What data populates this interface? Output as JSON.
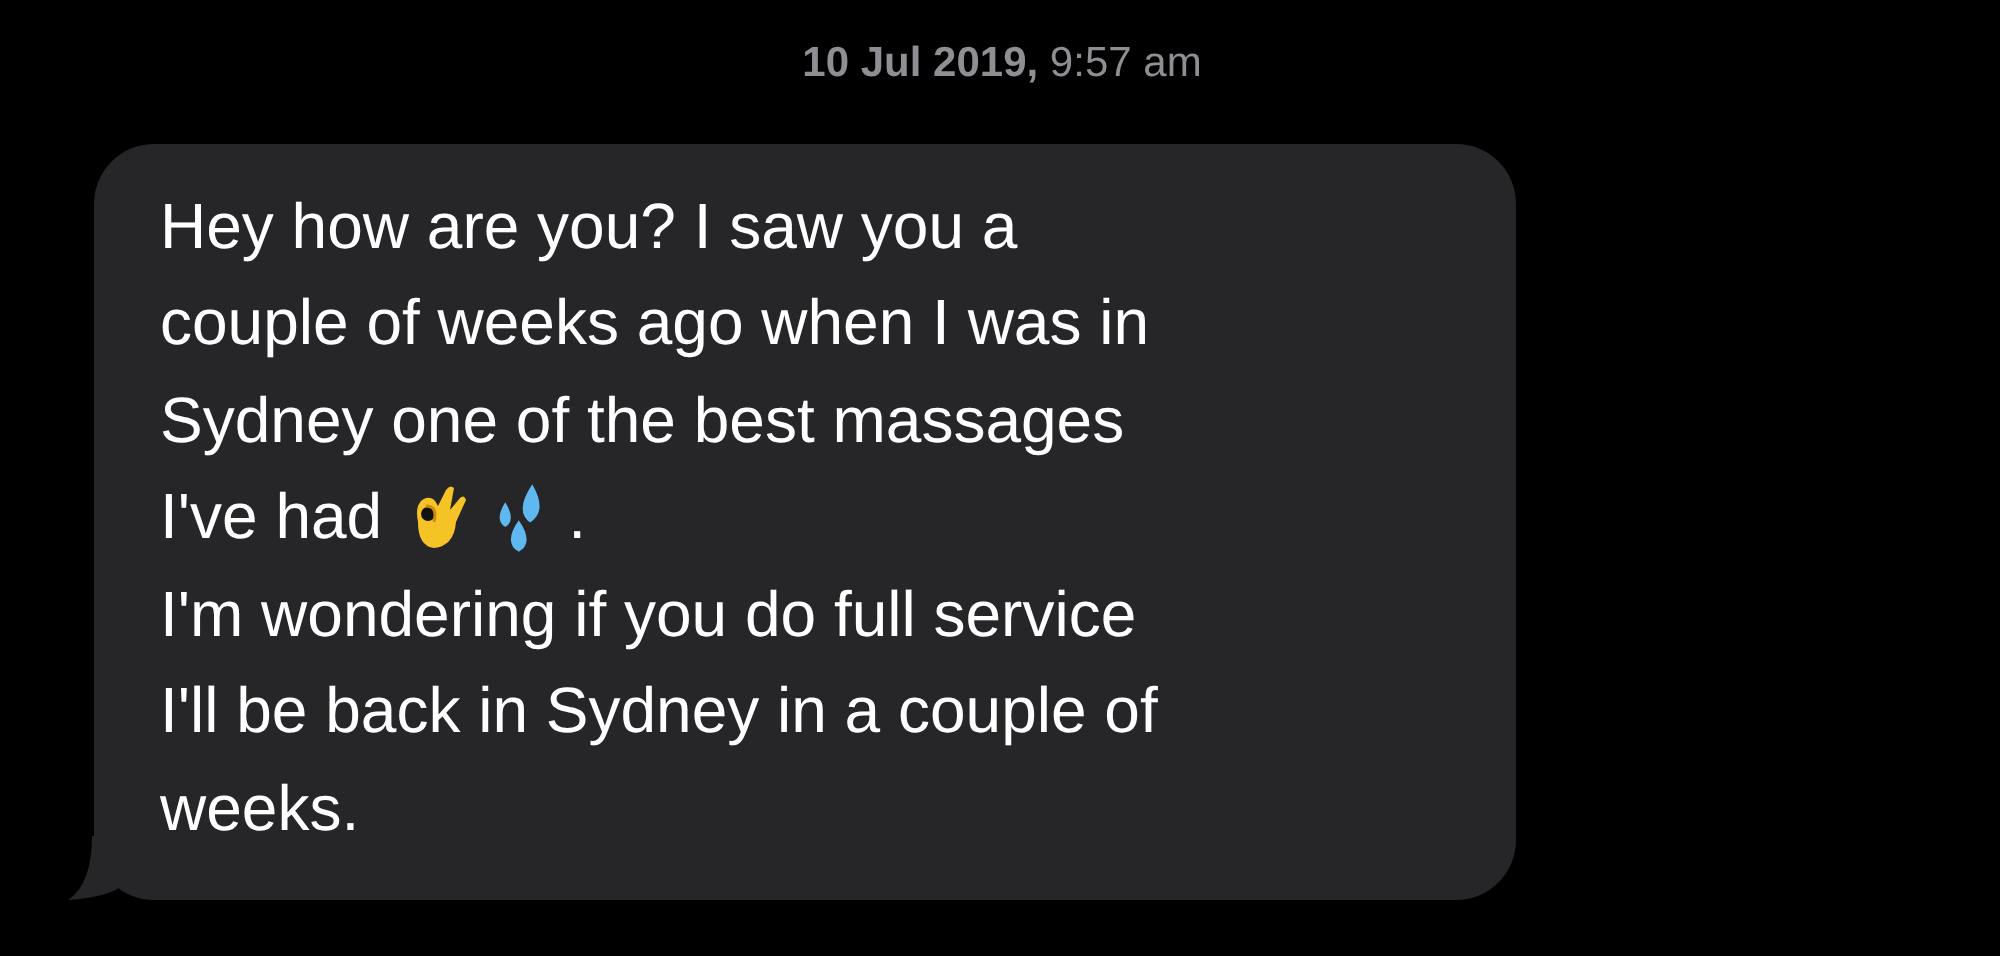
{
  "timestamp": {
    "date": "10 Jul 2019,",
    "time": "9:57 am"
  },
  "message": {
    "lines": [
      [
        {
          "kind": "text",
          "text": "Hey how are you? I saw you a"
        }
      ],
      [
        {
          "kind": "text",
          "text": "couple of weeks ago when I was in"
        }
      ],
      [
        {
          "kind": "text",
          "text": "Sydney one of the best massages"
        }
      ],
      [
        {
          "kind": "text",
          "text": "I've had"
        },
        {
          "kind": "ok-hand"
        },
        {
          "kind": "droplets"
        },
        {
          "kind": "text",
          "text": "."
        }
      ],
      [
        {
          "kind": "text",
          "text": "I'm wondering if you do full service"
        }
      ],
      [
        {
          "kind": "text",
          "text": "I'll be back in Sydney in a couple of"
        }
      ],
      [
        {
          "kind": "text",
          "text": "weeks."
        }
      ]
    ]
  }
}
